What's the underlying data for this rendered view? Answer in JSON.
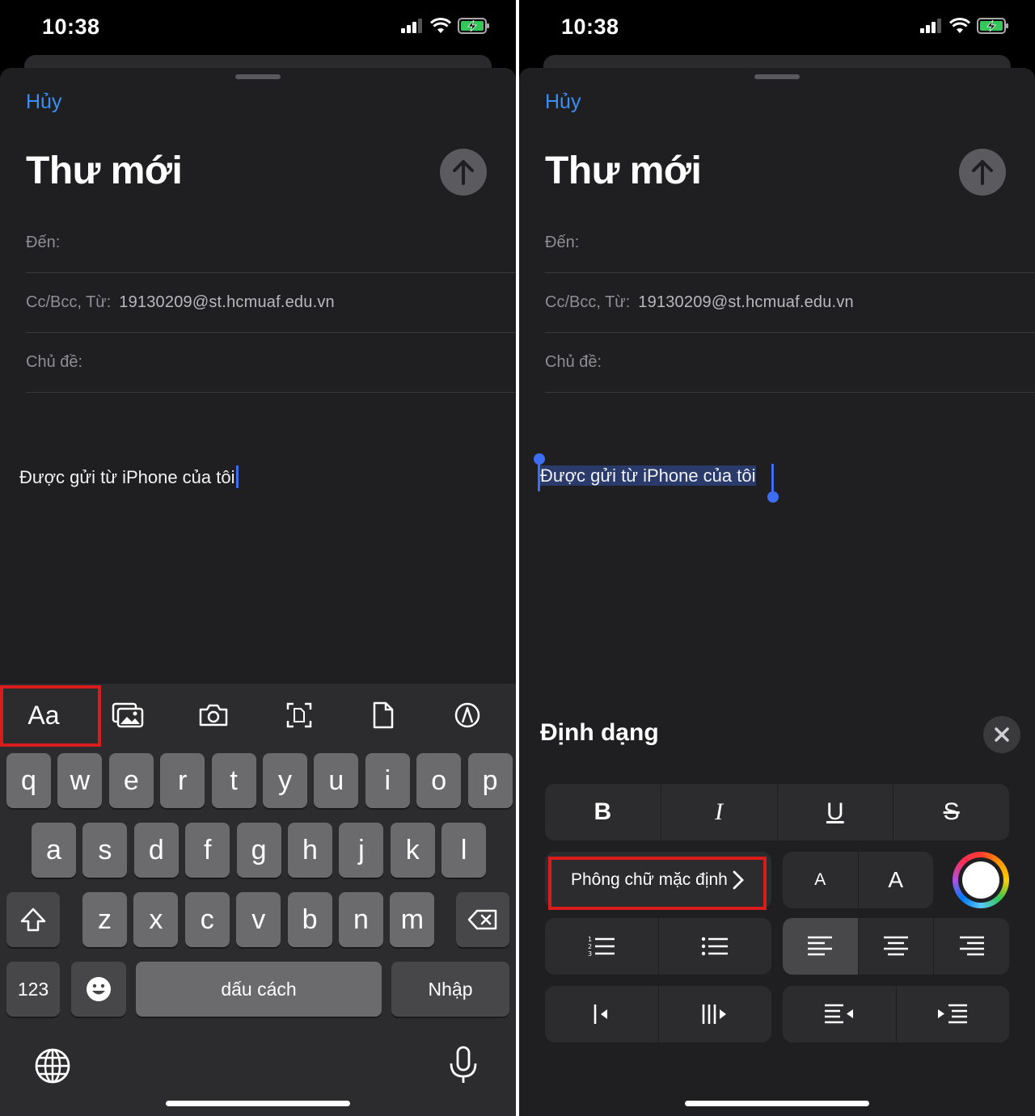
{
  "status": {
    "time": "10:38"
  },
  "compose": {
    "cancel": "Hủy",
    "title": "Thư mới",
    "to_label": "Đến:",
    "cc_label": "Cc/Bcc, Từ:",
    "from_value": "19130209@st.hcmuaf.edu.vn",
    "subject_label": "Chủ đề:",
    "body": "Được gửi từ iPhone của tôi"
  },
  "keyboard": {
    "row1": [
      "q",
      "w",
      "e",
      "r",
      "t",
      "y",
      "u",
      "i",
      "o",
      "p"
    ],
    "row2": [
      "a",
      "s",
      "d",
      "f",
      "g",
      "h",
      "j",
      "k",
      "l"
    ],
    "row3": [
      "z",
      "x",
      "c",
      "v",
      "b",
      "n",
      "m"
    ],
    "numbers_label": "123",
    "space_label": "dấu cách",
    "return_label": "Nhập",
    "toolbar_format_label": "Aa"
  },
  "format_panel": {
    "title": "Định dạng",
    "bold": "B",
    "italic": "I",
    "underline": "U",
    "strikethrough": "S",
    "font_label": "Phông chữ mặc định",
    "smaller_a": "A",
    "larger_a": "A"
  },
  "colors": {
    "accent": "#3b8ef5",
    "highlight": "#d91c1c",
    "background": "#1f1f21"
  }
}
